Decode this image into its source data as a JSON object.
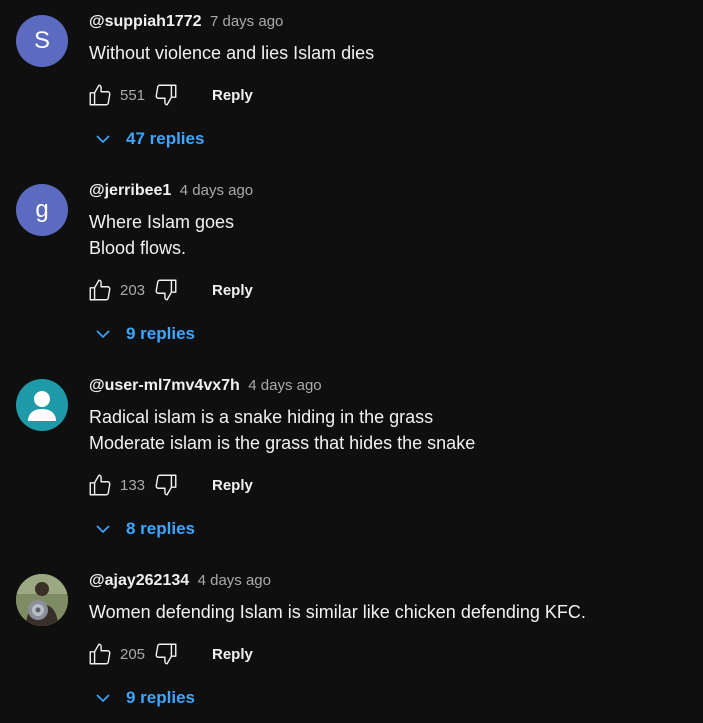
{
  "colors": {
    "background": "#0f0f0f",
    "link": "#3ea6ff",
    "muted": "#aaaaaa"
  },
  "comments": [
    {
      "avatar": {
        "type": "letter",
        "letter": "S",
        "color": "#5c6bc0"
      },
      "author": "@suppiah1772",
      "time": "7 days ago",
      "lines": [
        "Without violence and lies Islam dies"
      ],
      "likes": "551",
      "reply_label": "Reply",
      "replies_label": "47 replies"
    },
    {
      "avatar": {
        "type": "letter",
        "letter": "g",
        "color": "#5c6bc0"
      },
      "author": "@jerribee1",
      "time": "4 days ago",
      "lines": [
        "Where Islam goes",
        "Blood flows."
      ],
      "likes": "203",
      "reply_label": "Reply",
      "replies_label": "9 replies"
    },
    {
      "avatar": {
        "type": "default-user",
        "color": "#1e9aa8"
      },
      "author": "@user-ml7mv4vx7h",
      "time": "4 days ago",
      "lines": [
        "Radical islam is a snake hiding in the grass",
        "Moderate islam is the grass that hides the snake"
      ],
      "likes": "133",
      "reply_label": "Reply",
      "replies_label": "8 replies"
    },
    {
      "avatar": {
        "type": "photo",
        "color": "#6b7d55"
      },
      "author": "@ajay262134",
      "time": "4 days ago",
      "lines": [
        "Women defending Islam is similar like chicken defending KFC."
      ],
      "likes": "205",
      "reply_label": "Reply",
      "replies_label": "9 replies"
    }
  ]
}
